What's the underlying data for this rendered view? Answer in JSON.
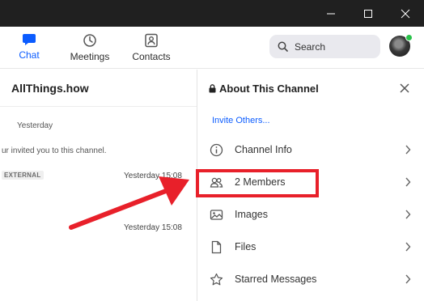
{
  "window": {
    "controls": [
      {
        "name": "minimize-icon"
      },
      {
        "name": "maximize-icon"
      },
      {
        "name": "close-icon"
      }
    ]
  },
  "nav": {
    "chat_label": "Chat",
    "meetings_label": "Meetings",
    "contacts_label": "Contacts",
    "active": "Chat"
  },
  "search": {
    "placeholder": "Search"
  },
  "chat": {
    "title": "AllThings.how",
    "date_separator": "Yesterday",
    "invite_text": "ur invited you to this channel.",
    "external_badge": "EXTERNAL",
    "message_time_1": "Yesterday 15:08",
    "message_time_2": "Yesterday 15:08"
  },
  "panel": {
    "title": "About This Channel",
    "invite_link": "Invite Others...",
    "items": [
      {
        "label": "Channel Info",
        "icon": "info-icon"
      },
      {
        "label": "2 Members",
        "icon": "members-icon"
      },
      {
        "label": "Images",
        "icon": "image-icon"
      },
      {
        "label": "Files",
        "icon": "file-icon"
      },
      {
        "label": "Starred Messages",
        "icon": "star-icon"
      }
    ]
  },
  "colors": {
    "accent": "#0b5cff",
    "titlebar": "#202020",
    "annotation": "#e8202a",
    "online": "#29c24a"
  }
}
